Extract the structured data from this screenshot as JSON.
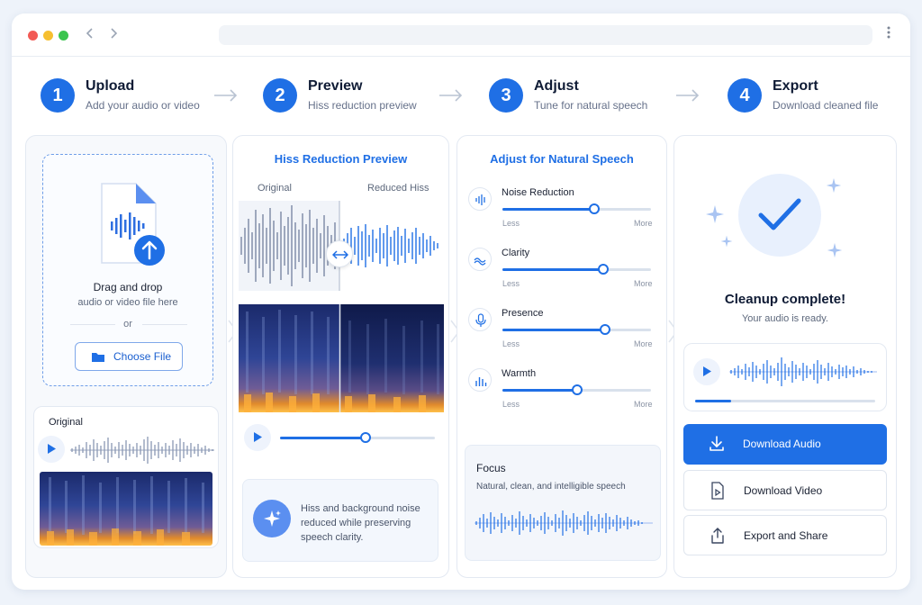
{
  "steps": [
    {
      "number": "1",
      "title": "Upload",
      "subtitle": "Add your audio or video"
    },
    {
      "number": "2",
      "title": "Preview",
      "subtitle": "Hiss reduction preview"
    },
    {
      "number": "3",
      "title": "Adjust",
      "subtitle": "Tune for natural speech"
    },
    {
      "number": "4",
      "title": "Export",
      "subtitle": "Download cleaned file"
    }
  ],
  "upload": {
    "drop_title": "Drag and drop",
    "drop_subtitle": "audio or video file here",
    "or": "or",
    "choose_file": "Choose File",
    "original_label": "Original"
  },
  "preview": {
    "title": "Hiss Reduction Preview",
    "original_label": "Original",
    "reduced_label": "Reduced Hiss",
    "playback_progress": 0.55,
    "note": "Hiss and background noise reduced while preserving speech clarity."
  },
  "adjust": {
    "title": "Adjust for Natural Speech",
    "sliders": [
      {
        "label": "Noise Reduction",
        "min_label": "Less",
        "max_label": "More",
        "value": 0.62,
        "icon": "noise-wave-icon"
      },
      {
        "label": "Clarity",
        "min_label": "Less",
        "max_label": "More",
        "value": 0.68,
        "icon": "clarity-wave-icon"
      },
      {
        "label": "Presence",
        "min_label": "Less",
        "max_label": "More",
        "value": 0.69,
        "icon": "microphone-icon"
      },
      {
        "label": "Warmth",
        "min_label": "Less",
        "max_label": "More",
        "value": 0.5,
        "icon": "equalizer-icon"
      }
    ],
    "focus_title": "Focus",
    "focus_text": "Natural, clean, and intelligible speech"
  },
  "export": {
    "complete_title": "Cleanup complete!",
    "complete_subtitle": "Your audio is ready.",
    "player_progress": 0.2,
    "download_audio": "Download Audio",
    "download_video": "Download Video",
    "export_share": "Export and Share"
  },
  "colors": {
    "accent": "#1f6fe5",
    "background": "#eef3fa"
  }
}
